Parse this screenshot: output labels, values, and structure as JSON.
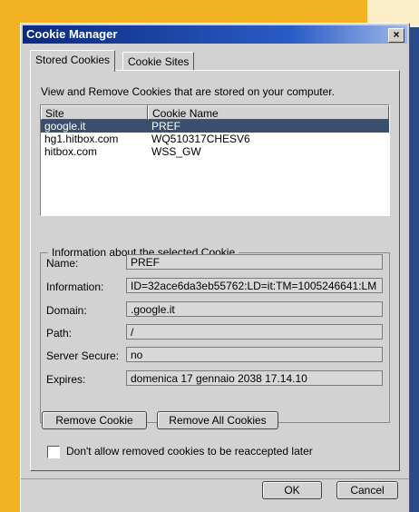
{
  "window": {
    "title": "Cookie Manager",
    "close": "×"
  },
  "tabs": [
    {
      "label": "Stored Cookies",
      "active": true
    },
    {
      "label": "Cookie Sites",
      "active": false
    }
  ],
  "description": "View and Remove Cookies that are stored on your computer.",
  "list": {
    "columns": [
      "Site",
      "Cookie Name"
    ],
    "rows": [
      {
        "site": "google.it",
        "name": "PREF",
        "selected": true
      },
      {
        "site": "hg1.hitbox.com",
        "name": "WQ510317CHESV6",
        "selected": false
      },
      {
        "site": "hitbox.com",
        "name": "WSS_GW",
        "selected": false
      }
    ]
  },
  "info": {
    "title": "Information about the selected Cookie",
    "fields": [
      {
        "label": "Name:",
        "value": "PREF"
      },
      {
        "label": "Information:",
        "value": "ID=32ace6da3eb55762:LD=it:TM=1005246641:LM"
      },
      {
        "label": "Domain:",
        "value": ".google.it"
      },
      {
        "label": "Path:",
        "value": "/"
      },
      {
        "label": "Server Secure:",
        "value": "no"
      },
      {
        "label": "Expires:",
        "value": "domenica 17 gennaio 2038 17.14.10"
      }
    ]
  },
  "buttons": {
    "remove": "Remove Cookie",
    "remove_all": "Remove All Cookies",
    "ok": "OK",
    "cancel": "Cancel"
  },
  "checkbox": {
    "label": "Don't allow removed cookies to be reaccepted later",
    "checked": false
  }
}
